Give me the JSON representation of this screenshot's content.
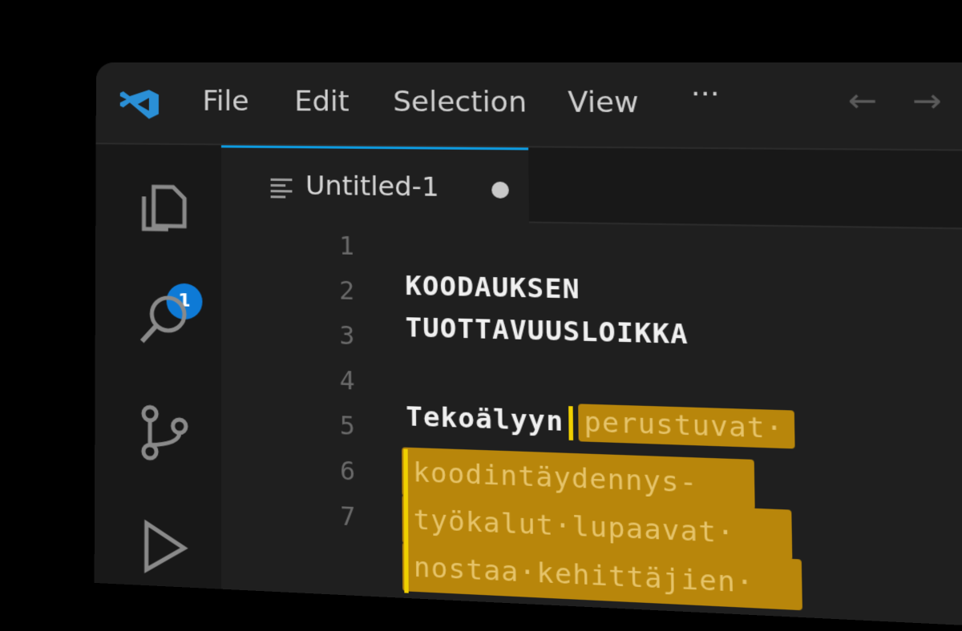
{
  "titlebar": {
    "menu": [
      "File",
      "Edit",
      "Selection",
      "View",
      "···"
    ]
  },
  "activity": {
    "explorer_badge": "1"
  },
  "tab": {
    "label": "Untitled-1"
  },
  "editor": {
    "line_numbers": [
      "1",
      "2",
      "3",
      "4",
      "5",
      "6",
      "7"
    ],
    "lines": {
      "l2": "KOODAUKSEN",
      "l3": "TUOTTAVUUSLOIKKA",
      "l5_plain": "Tekoälyyn",
      "l5_sel": "perustuvat·",
      "l6": "koodintäydennys-",
      "l7": "työkalut·lupaavat·",
      "l8": "nostaa·kehittäjien·"
    }
  },
  "colors": {
    "accent": "#0e9be0",
    "selection": "#b8860b",
    "cursor": "#f0d000",
    "badge": "#0e7ad6"
  }
}
